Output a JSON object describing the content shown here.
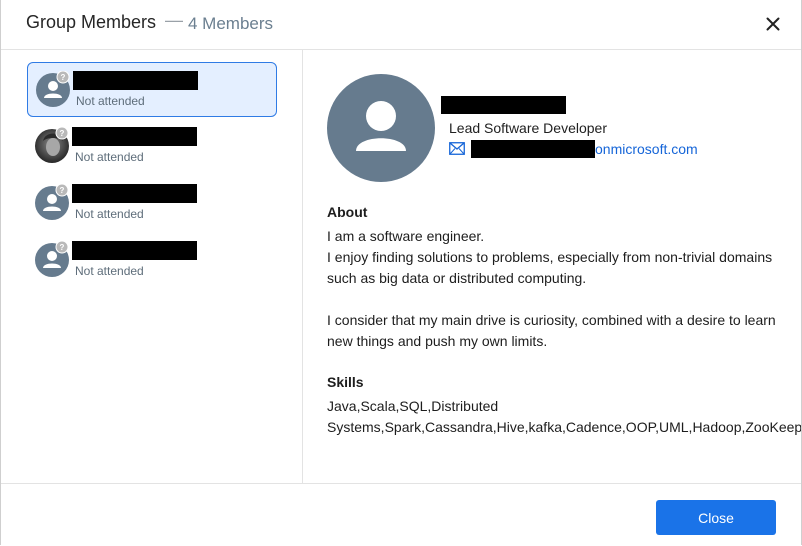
{
  "header": {
    "title": "Group Members",
    "dash": "—",
    "member_count": "4 Members",
    "close_icon": "close-icon"
  },
  "members": [
    {
      "status": "Not attended",
      "avatar": "person-placeholder",
      "selected": true
    },
    {
      "status": "Not attended",
      "avatar": "photo"
    },
    {
      "status": "Not attended",
      "avatar": "person-placeholder"
    },
    {
      "status": "Not attended",
      "avatar": "person-placeholder"
    }
  ],
  "profile": {
    "job_title": "Lead Software Developer",
    "email_domain": "onmicrosoft.com",
    "about_title": "About",
    "about_lines": [
      "I am a software engineer.",
      "I enjoy finding solutions to problems, especially from non-trivial domains",
      "such as big data or distributed computing.",
      "I consider that my main drive is curiosity, combined with a desire to learn",
      "new things and push my own limits."
    ],
    "skills_title": "Skills",
    "skills_lines": [
      "Java,Scala,SQL,Distributed",
      "Systems,Spark,Cassandra,Hive,kafka,Cadence,OOP,UML,Hadoop,ZooKeeper"
    ]
  },
  "footer": {
    "close_label": "Close"
  },
  "colors": {
    "accent": "#1a73e8",
    "avatar_bg": "#667b8e",
    "selected_bg": "#e4efff",
    "link": "#1565d8"
  }
}
